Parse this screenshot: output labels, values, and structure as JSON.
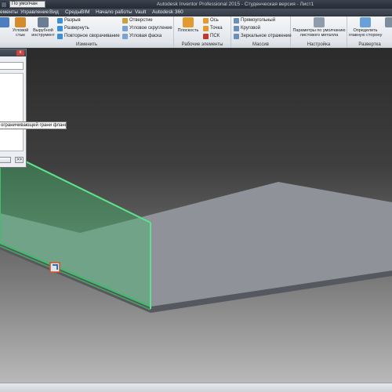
{
  "title_bar": {
    "style_combo_value": "По умолчан",
    "app_title": "Autodesk Inventor Professional 2015 - Студенческая версия - Лист1"
  },
  "ribbon_tabs": [
    "ементы",
    "Управление",
    "Вид",
    "Среды",
    "BIM",
    "Начало работы",
    "Vault",
    "Autodesk 360"
  ],
  "ribbon": {
    "modify_panel": {
      "title": "Изменить",
      "corner_seam_label": "Угловой стык",
      "punch_tool_label": "Вырубной инструмент",
      "small_buttons": [
        "Разрыв",
        "Развернуть",
        "Повторное сворачивание"
      ],
      "small_buttons_2": [
        "Отверстие",
        "Угловое скругление",
        "Угловая фаска"
      ]
    },
    "work_features_panel": {
      "title": "Рабочие элементы",
      "plane_label": "Плоскость",
      "small_buttons": [
        "Ось",
        "Точка",
        "ПСК"
      ]
    },
    "pattern_panel": {
      "title": "Массив",
      "small_buttons": [
        "Прямоугольный",
        "Круговой",
        "Зеркальное отражение"
      ]
    },
    "setup_panel": {
      "title": "Настройка",
      "sheet_metal_defaults_label": "Параметры по умолчанию листового металла"
    },
    "flat_pattern_panel": {
      "title": "Развертка",
      "define_a_side_label": "Определить главную сторону"
    }
  },
  "dialog": {
    "close_glyph": "x",
    "more_button_label": ">>"
  },
  "tooltip": {
    "text": "ограничивающей грани фланца"
  },
  "colors": {
    "flange_green": "#3fbf6a",
    "plate_face": "#8f9299",
    "ribbon_bg": "#eef0f3"
  }
}
